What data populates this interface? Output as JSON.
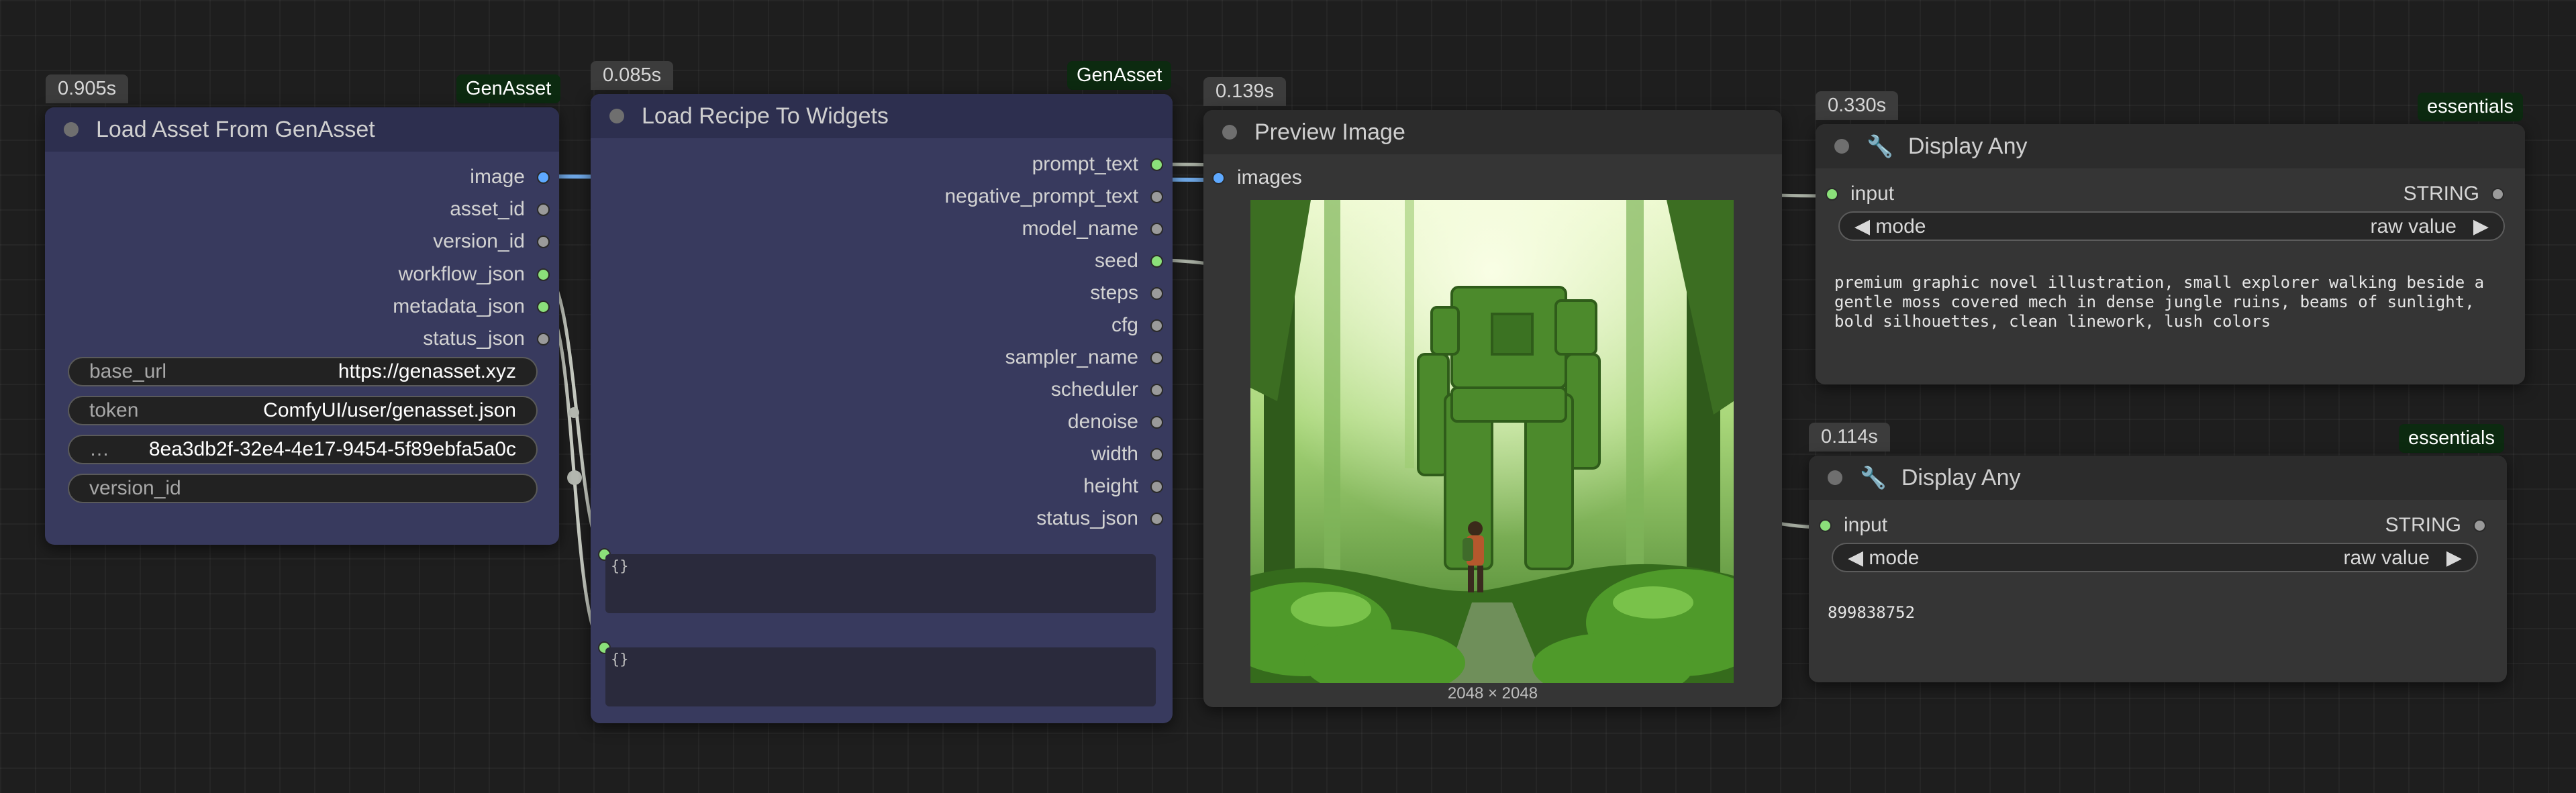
{
  "nodes": {
    "load_asset": {
      "time": "0.905s",
      "source": "GenAsset",
      "title": "Load Asset From GenAsset",
      "outputs": [
        "image",
        "asset_id",
        "version_id",
        "workflow_json",
        "metadata_json",
        "status_json"
      ],
      "widgets": [
        {
          "key": "base_url",
          "value": "https://genasset.xyz"
        },
        {
          "key": "token",
          "value": "ComfyUI/user/genasset.json"
        },
        {
          "key": "…",
          "value": "8ea3db2f-32e4-4e17-9454-5f89ebfa5a0c"
        },
        {
          "key": "version_id",
          "value": ""
        }
      ]
    },
    "load_recipe": {
      "time": "0.085s",
      "source": "GenAsset",
      "title": "Load Recipe To Widgets",
      "outputs": [
        "prompt_text",
        "negative_prompt_text",
        "model_name",
        "seed",
        "steps",
        "cfg",
        "sampler_name",
        "scheduler",
        "denoise",
        "width",
        "height",
        "status_json"
      ],
      "textbox1": "{}",
      "textbox2": "{}"
    },
    "preview": {
      "time": "0.139s",
      "title": "Preview Image",
      "input": "images",
      "dims": "2048 × 2048"
    },
    "display1": {
      "time": "0.330s",
      "source": "essentials",
      "title": "Display Any",
      "input": "input",
      "output": "STRING",
      "mode_label": "mode",
      "mode_value": "raw value",
      "text": "premium graphic novel illustration, small explorer walking beside a\ngentle moss covered mech in dense jungle ruins, beams of sunlight,\nbold silhouettes, clean linework, lush colors"
    },
    "display2": {
      "time": "0.114s",
      "source": "essentials",
      "title": "Display Any",
      "input": "input",
      "output": "STRING",
      "mode_label": "mode",
      "mode_value": "raw value",
      "text": "899838752"
    }
  },
  "colors": {
    "node_purple": "#383a5e",
    "node_gray": "#353535",
    "socket_green": "#8be07a",
    "socket_blue": "#5ea9ff",
    "tag_green": "#0c2a10"
  }
}
